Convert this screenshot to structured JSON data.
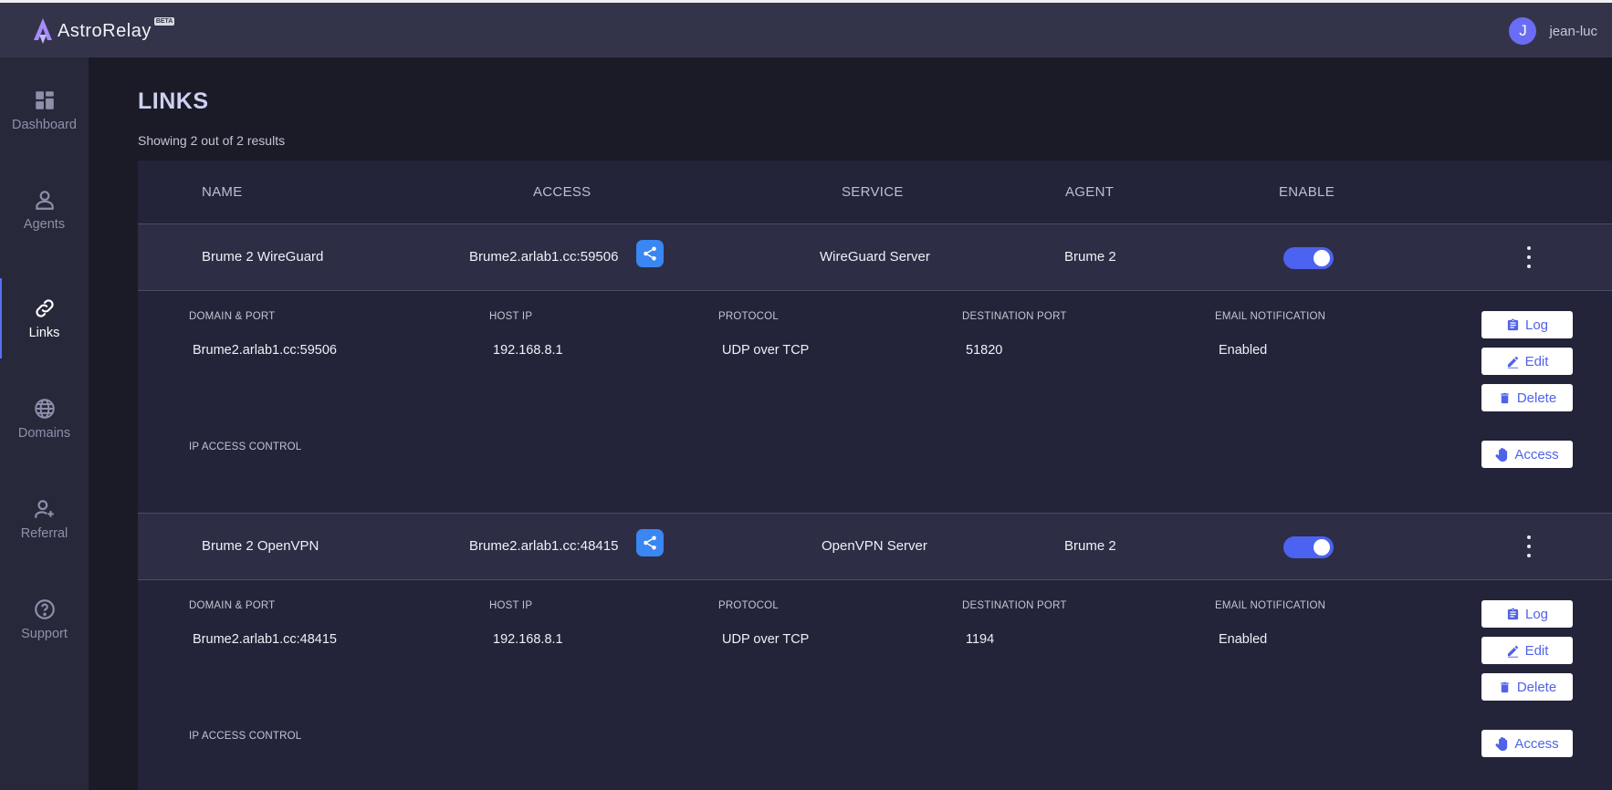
{
  "app": {
    "name": "AstroRelay",
    "badge": "BETA"
  },
  "user": {
    "initial": "J",
    "name": "jean-luc"
  },
  "sidebar": {
    "items": [
      {
        "label": "Dashboard",
        "icon": "dashboard-icon"
      },
      {
        "label": "Agents",
        "icon": "person-icon"
      },
      {
        "label": "Links",
        "icon": "link-icon",
        "active": true
      },
      {
        "label": "Domains",
        "icon": "globe-icon"
      },
      {
        "label": "Referral",
        "icon": "person-add-icon"
      },
      {
        "label": "Support",
        "icon": "help-icon"
      }
    ]
  },
  "page": {
    "title": "LINKS",
    "result_count": "Showing 2 out of 2 results"
  },
  "table": {
    "columns": {
      "name": "NAME",
      "access": "ACCESS",
      "service": "SERVICE",
      "agent": "AGENT",
      "enable": "ENABLE"
    },
    "detail_labels": {
      "domain_port": "DOMAIN & PORT",
      "host_ip": "HOST IP",
      "protocol": "PROTOCOL",
      "destination_port": "DESTINATION PORT",
      "email_notification": "EMAIL NOTIFICATION",
      "ip_access_control": "IP ACCESS CONTROL"
    },
    "actions": {
      "log": "Log",
      "edit": "Edit",
      "delete": "Delete",
      "access": "Access"
    },
    "rows": [
      {
        "name": "Brume 2 WireGuard",
        "access": "Brume2.arlab1.cc:59506",
        "service": "WireGuard Server",
        "agent": "Brume 2",
        "enabled": true,
        "detail": {
          "domain_port": "Brume2.arlab1.cc:59506",
          "host_ip": "192.168.8.1",
          "protocol": "UDP over TCP",
          "destination_port": "51820",
          "email_notification": "Enabled"
        }
      },
      {
        "name": "Brume 2 OpenVPN",
        "access": "Brume2.arlab1.cc:48415",
        "service": "OpenVPN Server",
        "agent": "Brume 2",
        "enabled": true,
        "detail": {
          "domain_port": "Brume2.arlab1.cc:48415",
          "host_ip": "192.168.8.1",
          "protocol": "UDP over TCP",
          "destination_port": "1194",
          "email_notification": "Enabled"
        }
      }
    ]
  },
  "colors": {
    "accent": "#4b63f0",
    "share": "#3a86f2",
    "topbar": "#33344a",
    "sidebar": "#272839"
  }
}
